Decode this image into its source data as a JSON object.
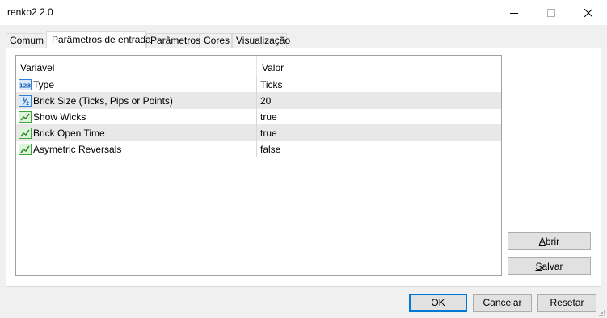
{
  "window": {
    "title": "renko2 2.0",
    "controls": [
      "minimize",
      "maximize",
      "close"
    ]
  },
  "tabs": [
    {
      "label": "Comum",
      "active": false
    },
    {
      "label": "Parâmetros de entrada",
      "active": true
    },
    {
      "label": "Parâmetros",
      "active": false
    },
    {
      "label": "Cores",
      "active": false
    },
    {
      "label": "Visualização",
      "active": false
    }
  ],
  "grid": {
    "columns": {
      "variable": "Variável",
      "value": "Valor"
    },
    "rows": [
      {
        "icon": "integer-123-icon",
        "variable": "Type",
        "value": "Ticks"
      },
      {
        "icon": "fraction-half-icon",
        "variable": "Brick Size (Ticks, Pips or Points)",
        "value": "20"
      },
      {
        "icon": "boolean-chart-icon",
        "variable": "Show Wicks",
        "value": "true"
      },
      {
        "icon": "boolean-chart-icon",
        "variable": "Brick Open Time",
        "value": "true"
      },
      {
        "icon": "boolean-chart-icon",
        "variable": "Asymetric Reversals",
        "value": "false"
      }
    ]
  },
  "side_buttons": {
    "abrir": {
      "first": "A",
      "rest": "brir"
    },
    "salvar": {
      "first": "S",
      "rest": "alvar"
    }
  },
  "footer_buttons": {
    "ok": "OK",
    "cancel": "Cancelar",
    "reset": "Resetar"
  },
  "colors": {
    "focus_border": "#0078d7",
    "selected_row": "#e8e8e8",
    "icon_green": "#3aa635",
    "icon_blue": "#2f7fd8"
  }
}
